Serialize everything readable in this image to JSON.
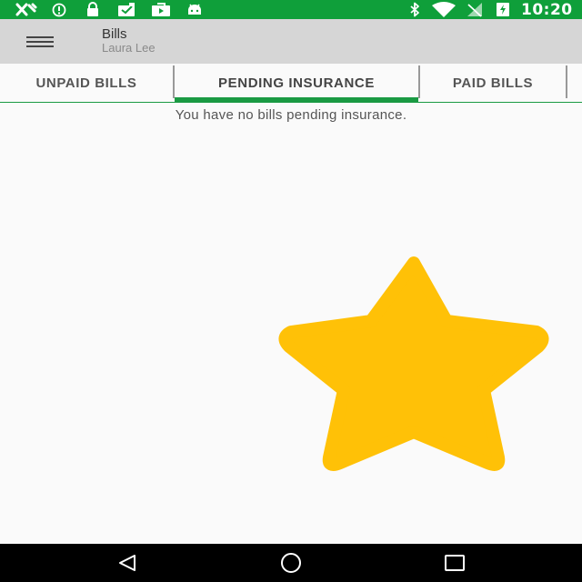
{
  "status_bar": {
    "time": "10:20",
    "icons_left": [
      "radar-icon",
      "alert-circle-icon",
      "lock-icon",
      "inbox-icon",
      "play-store-icon",
      "android-icon"
    ],
    "icons_right": [
      "bluetooth-icon",
      "wifi-icon",
      "no-signal-icon",
      "battery-charging-icon"
    ],
    "background": "#0f9f3a"
  },
  "app_bar": {
    "title": "Bills",
    "subtitle": "Laura Lee",
    "menu_icon": "hamburger-menu-icon"
  },
  "tabs": [
    {
      "label": "UNPAID BILLS",
      "active": false
    },
    {
      "label": "PENDING INSURANCE",
      "active": true
    },
    {
      "label": "PAID BILLS",
      "active": false
    }
  ],
  "accent_color": "#1a9a43",
  "content": {
    "empty_message": "You have no bills pending insurance.",
    "star_icon": "star-icon",
    "star_color": "#ffc107"
  },
  "nav_bar": {
    "back": "back-icon",
    "home": "home-icon",
    "recents": "recents-icon"
  }
}
